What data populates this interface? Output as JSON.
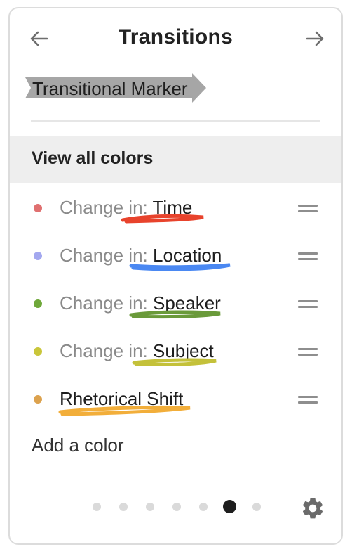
{
  "header": {
    "title": "Transitions",
    "back_icon": "arrow-left-icon",
    "forward_icon": "arrow-right-icon"
  },
  "marker": {
    "label": "Transitional Marker",
    "color": "#a6a6a6"
  },
  "view_all": {
    "label": "View all colors"
  },
  "colors": [
    {
      "prefix": "Change in: ",
      "label": "Time",
      "dot": "#e07070",
      "underline": "#e8432c"
    },
    {
      "prefix": "Change in: ",
      "label": "Location",
      "dot": "#a3a8ef",
      "underline": "#4a88f2"
    },
    {
      "prefix": "Change in: ",
      "label": "Speaker",
      "dot": "#6fa83a",
      "underline": "#6a9a3a"
    },
    {
      "prefix": "Change in: ",
      "label": "Subject",
      "dot": "#c9c63a",
      "underline": "#c4c13a"
    },
    {
      "prefix": "",
      "label": "Rhetorical Shift",
      "dot": "#dca24e",
      "underline": "#f2ae3a"
    }
  ],
  "add_color": {
    "label": "Add a color"
  },
  "pager": {
    "count": 7,
    "active_index": 5
  },
  "footer": {
    "settings_icon": "gear-icon"
  }
}
